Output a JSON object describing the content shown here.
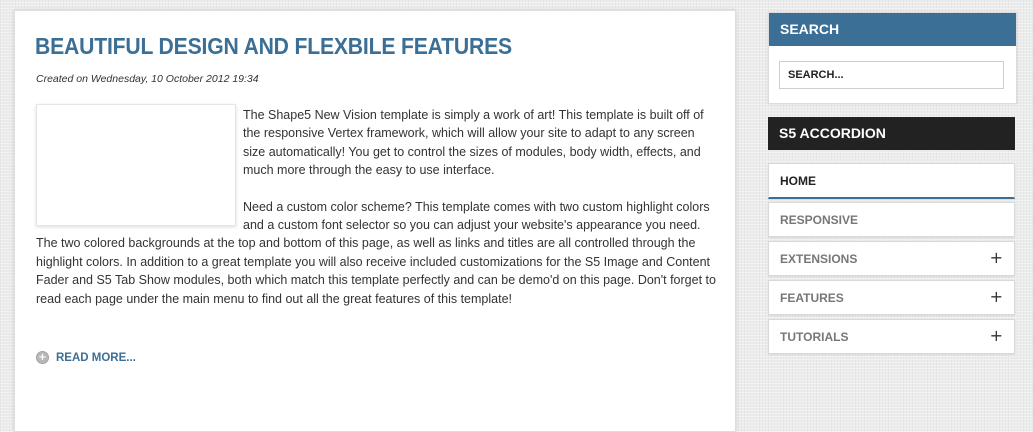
{
  "article": {
    "title": "BEAUTIFUL DESIGN AND FLEXBILE FEATURES",
    "created": "Created on Wednesday, 10 October 2012 19:34",
    "paragraphs": [
      "The Shape5 New Vision template is simply a work of art! This template is built off of the responsive Vertex framework, which will allow your site to adapt to any screen size automatically! You get to control the sizes of modules, body width, effects, and much more through the easy to use interface.",
      "Need a custom color scheme? This template comes with two custom highlight colors and a custom font selector so you can adjust your website's appearance you need. The two colored backgrounds at the top and bottom of this page, as well as links and titles are all controlled through the highlight colors. In addition to a great template you will also receive included customizations for the S5 Image and Content Fader and S5 Tab Show modules, both which match this template perfectly and can be demo'd on this page. Don't forget to read each page under the main menu to find out all the great features of this template!"
    ],
    "read_more": "READ MORE...",
    "read_more_icon": "plus-circle-icon"
  },
  "search": {
    "title": "SEARCH",
    "placeholder": "SEARCH..."
  },
  "accordion": {
    "title": "S5 ACCORDION",
    "items": [
      {
        "label": "HOME",
        "has_plus": false
      },
      {
        "label": "RESPONSIVE",
        "has_plus": false
      },
      {
        "label": "EXTENSIONS",
        "has_plus": true
      },
      {
        "label": "FEATURES",
        "has_plus": true
      },
      {
        "label": "TUTORIALS",
        "has_plus": true
      }
    ],
    "plus_symbol": "+"
  },
  "colors": {
    "accent": "#3b6f95",
    "dark_header": "#222222",
    "text": "#333333"
  }
}
